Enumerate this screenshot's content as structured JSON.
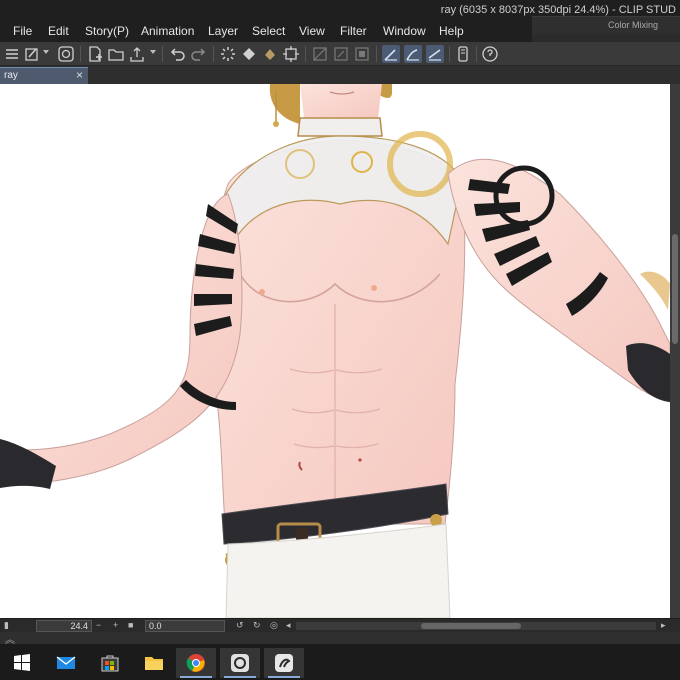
{
  "window": {
    "title": "ray (6035 x 8037px 350dpi 24.4%)  - CLIP STUD",
    "palette_tab_label": "Color Mixing"
  },
  "menu": {
    "items": [
      "File",
      "Edit",
      "Story(P)",
      "Animation",
      "Layer",
      "Select",
      "View",
      "Filter",
      "Window",
      "Help"
    ]
  },
  "toolbar": {
    "icons": [
      "menu-icon",
      "command-bar-icon",
      "clip-studio-icon",
      "new-file-icon",
      "open-file-icon",
      "export-icon",
      "undo-icon",
      "redo-icon",
      "loading-icon",
      "fill-icon",
      "transform-icon",
      "clear-outside-icon",
      "fill-selection-icon",
      "show-selection-icon",
      "stabilization-low-icon",
      "stabilization-mid-icon",
      "stabilization-high-icon",
      "tablet-icon",
      "help-icon"
    ]
  },
  "document_tab": {
    "label": "ray",
    "close": "×"
  },
  "status": {
    "zoom": "24.4",
    "rotation": "0.0"
  },
  "taskbar": {
    "apps": [
      "windows-start",
      "mail",
      "store",
      "file-explorer",
      "chrome",
      "clip-studio",
      "clip-studio-paint"
    ]
  },
  "colors": {
    "accent": "#4e5b6f",
    "canvas": "#ffffff",
    "chrome_dark": "#1f1f1f",
    "toolbar": "#3a3a3a"
  }
}
